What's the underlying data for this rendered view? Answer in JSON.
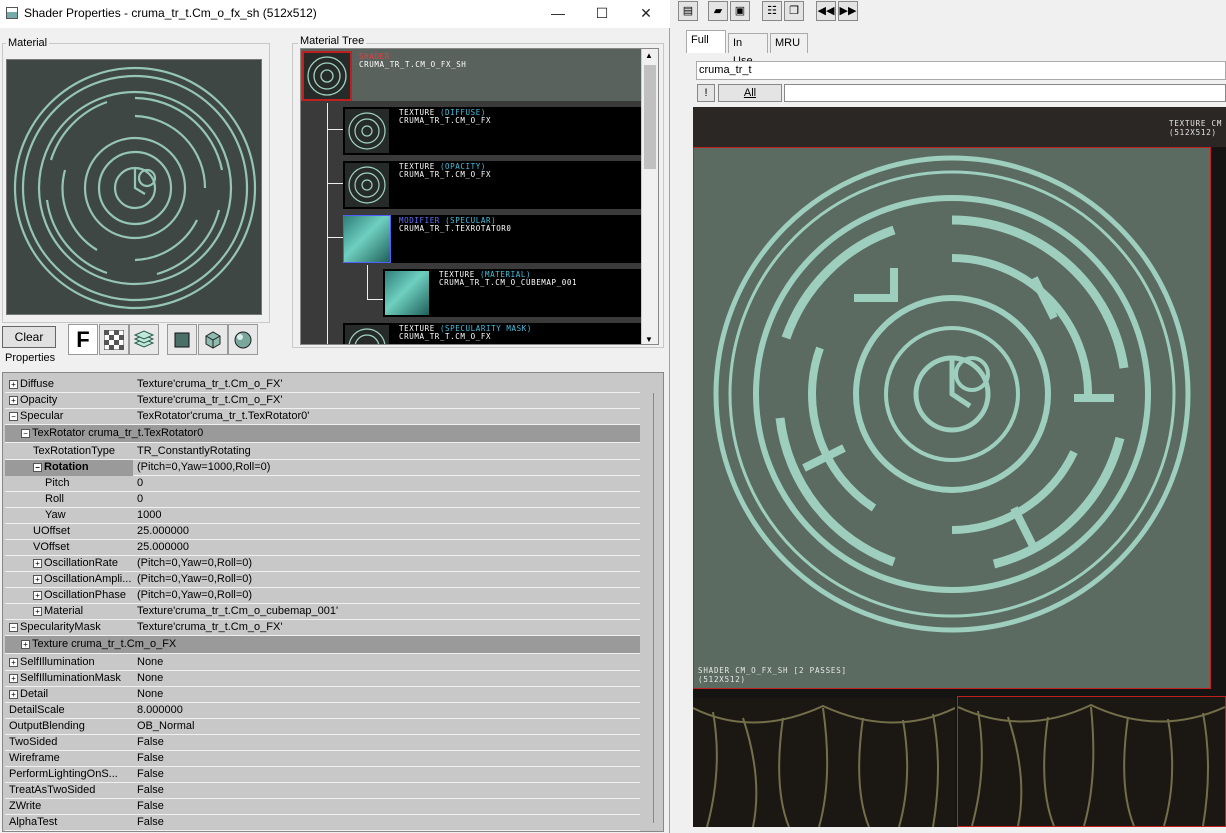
{
  "window": {
    "title": "Shader Properties - cruma_tr_t.Cm_o_fx_sh (512x512)",
    "minimize": "—",
    "maximize": "☐",
    "close": "✕"
  },
  "material_group": {
    "label": "Material"
  },
  "tree_group": {
    "label": "Material Tree"
  },
  "toolbar": {
    "clear": "Clear",
    "font_btn": "F"
  },
  "tree": {
    "root": {
      "kind": "SHADER",
      "name": "CRUMA_TR_T.CM_O_FX_SH"
    },
    "nodes": [
      {
        "kind": "TEXTURE",
        "slot": "(DIFFUSE)",
        "name": "CRUMA_TR_T.CM_O_FX"
      },
      {
        "kind": "TEXTURE",
        "slot": "(OPACITY)",
        "name": "CRUMA_TR_T.CM_O_FX"
      },
      {
        "kind": "MODIFIER",
        "slot": "(SPECULAR)",
        "name": "CRUMA_TR_T.TEXROTATOR0"
      },
      {
        "kind": "TEXTURE",
        "slot": "(MATERIAL)",
        "name": "CRUMA_TR_T.CM_O_CUBEMAP_001"
      },
      {
        "kind": "TEXTURE",
        "slot": "(SPECULARITY MASK)",
        "name": "CRUMA_TR_T.CM_O_FX"
      }
    ]
  },
  "properties_label": "Properties",
  "properties": [
    {
      "name": "Diffuse",
      "value": "Texture'cruma_tr_t.Cm_o_FX'",
      "exp": "+"
    },
    {
      "name": "Opacity",
      "value": "Texture'cruma_tr_t.Cm_o_FX'",
      "exp": "+"
    },
    {
      "name": "Specular",
      "value": "TexRotator'cruma_tr_t.TexRotator0'",
      "exp": "−"
    },
    {
      "name": "TexRotator cruma_tr_t.TexRotator0",
      "value": "",
      "section": true
    },
    {
      "name": "TexRotationType",
      "value": "TR_ConstantlyRotating"
    },
    {
      "name": "Rotation",
      "value": "(Pitch=0,Yaw=1000,Roll=0)",
      "exp": "−",
      "selected": true
    },
    {
      "name": "Pitch",
      "value": "0"
    },
    {
      "name": "Roll",
      "value": "0"
    },
    {
      "name": "Yaw",
      "value": "1000"
    },
    {
      "name": "UOffset",
      "value": "25.000000"
    },
    {
      "name": "VOffset",
      "value": "25.000000"
    },
    {
      "name": "OscillationRate",
      "value": "(Pitch=0,Yaw=0,Roll=0)",
      "exp": "+"
    },
    {
      "name": "OscillationAmpli...",
      "value": "(Pitch=0,Yaw=0,Roll=0)",
      "exp": "+"
    },
    {
      "name": "OscillationPhase",
      "value": "(Pitch=0,Yaw=0,Roll=0)",
      "exp": "+"
    },
    {
      "name": "Material",
      "value": "Texture'cruma_tr_t.Cm_o_cubemap_001'",
      "exp": "+"
    },
    {
      "name": "SpecularityMask",
      "value": "Texture'cruma_tr_t.Cm_o_FX'",
      "exp": "−"
    },
    {
      "name": "Texture cruma_tr_t.Cm_o_FX",
      "value": "",
      "section": true
    },
    {
      "name": "SelfIllumination",
      "value": "None",
      "exp": "+"
    },
    {
      "name": "SelfIlluminationMask",
      "value": "None",
      "exp": "+"
    },
    {
      "name": "Detail",
      "value": "None",
      "exp": "+"
    },
    {
      "name": "DetailScale",
      "value": "8.000000"
    },
    {
      "name": "OutputBlending",
      "value": "OB_Normal"
    },
    {
      "name": "TwoSided",
      "value": "False"
    },
    {
      "name": "Wireframe",
      "value": "False"
    },
    {
      "name": "PerformLightingOnS...",
      "value": "False"
    },
    {
      "name": "TreatAsTwoSided",
      "value": "False"
    },
    {
      "name": "ZWrite",
      "value": "False"
    },
    {
      "name": "AlphaTest",
      "value": "False"
    }
  ],
  "browser": {
    "tabs": [
      "Full",
      "In Use",
      "MRU"
    ],
    "filter": "cruma_tr_t",
    "excl": "!",
    "all": "All",
    "top_caption1": "TEXTURE CM",
    "top_caption2": "(512X512)",
    "tile_caption1": "SHADER CM_O_FX_SH [2 PASSES]",
    "tile_caption2": "(512X512)"
  },
  "colors": {
    "selection": "#c02020",
    "texture_slot": "#40c0e0",
    "modifier": "#6070ff"
  }
}
